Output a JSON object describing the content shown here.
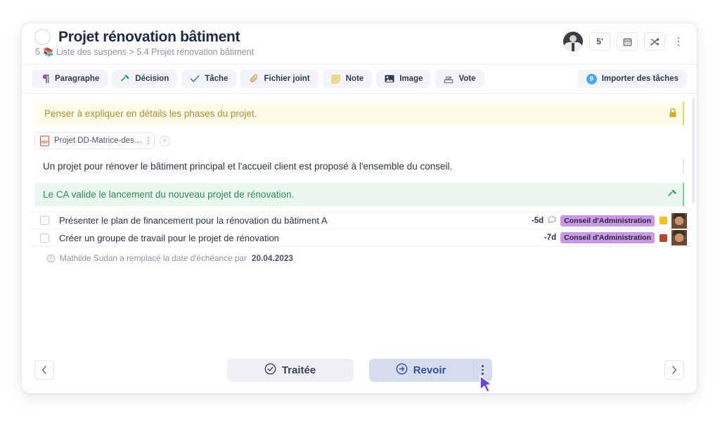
{
  "header": {
    "status_icon": "circle-outline-icon",
    "title": "Projet rénovation bâtiment",
    "breadcrumb_number": "5",
    "breadcrumb_emoji": "📚",
    "breadcrumb_path": "Liste des suspens > 5.4 Projet rénovation bâtiment",
    "avatar_name": "avatar",
    "timer_label": "5'",
    "calendar_icon": "calendar-icon",
    "shuffle_icon": "shuffle-off-icon",
    "more_icon": "more-vertical-icon"
  },
  "toolbar": {
    "buttons": [
      {
        "label": "Paragraphe",
        "icon": "pilcrow-icon",
        "glyph": "¶",
        "color": "#8a56a8"
      },
      {
        "label": "Décision",
        "icon": "gavel-icon",
        "glyph": "🔨",
        "color": "#2e9e5b"
      },
      {
        "label": "Tâche",
        "icon": "check-icon",
        "glyph": "✓",
        "color": "#3f7ee0"
      },
      {
        "label": "Fichier joint",
        "icon": "paperclip-icon",
        "glyph": "📎",
        "color": "#c8a96a"
      },
      {
        "label": "Note",
        "icon": "sticky-note-icon",
        "glyph": "🗒",
        "color": "#e0c24a"
      },
      {
        "label": "Image",
        "icon": "image-icon",
        "glyph": "🖼",
        "color": "#2f3a53"
      },
      {
        "label": "Vote",
        "icon": "ballot-box-icon",
        "glyph": "🗳",
        "color": "#5a6377"
      }
    ],
    "import_button": {
      "label": "Importer des tâches",
      "badge": "9",
      "badge_color": "#45a7f5",
      "icon": "import-tasks-icon"
    }
  },
  "content": {
    "note_block": {
      "text": "Penser à expliquer en détails les phases du projet.",
      "lock_icon": "lock-icon",
      "bg_color": "#fdfbe9",
      "text_color": "#a8902f",
      "edge_color": "#e8d56a"
    },
    "attachment": {
      "file_name": "Projet DD-Matrice-des…",
      "file_type_label": "PDF",
      "menu_icon": "more-vertical-icon",
      "add_icon": "plus-circle-icon"
    },
    "paragraph_block": {
      "text": "Un projet pour rénover le bâtiment principal et l'accueil client est proposé à l'ensemble du conseil."
    },
    "decision_block": {
      "text": "Le CA valide le lancement du nouveau projet de rénovation.",
      "gavel_icon": "gavel-icon",
      "bg_color": "#e9f7ee",
      "text_color": "#2e8b57",
      "edge_color": "#7fcf9c"
    },
    "tasks": [
      {
        "checked": false,
        "label": "Présenter le plan de financement pour la rénovation du bâtiment A",
        "due": "-5d",
        "has_comment": true,
        "comment_icon": "comment-icon",
        "tag": "Conseil d'Administration",
        "tag_color": "#c89ae0",
        "square_color": "#f0c419",
        "avatar": "avatar"
      },
      {
        "checked": false,
        "label": "Créer un groupe de travail pour le projet de rénovation",
        "due": "-7d",
        "has_comment": false,
        "comment_icon": "comment-icon",
        "tag": "Conseil d'Administration",
        "tag_color": "#c89ae0",
        "square_color": "#b3472f",
        "avatar": "avatar"
      }
    ],
    "history": {
      "info_icon": "info-icon",
      "text_prefix": "Mathilde Sudan a remplacé la date d'échéance par ",
      "date": "20.04.2023"
    }
  },
  "footer": {
    "prev_icon": "chevron-left-icon",
    "next_icon": "chevron-right-icon",
    "traitee": {
      "label": "Traitée",
      "icon": "check-circle-icon"
    },
    "revoir": {
      "label": "Revoir",
      "icon": "arrow-circle-right-icon",
      "menu_icon": "more-vertical-icon",
      "bg_color": "#d5dcec",
      "text_color": "#2e4fa3"
    }
  }
}
